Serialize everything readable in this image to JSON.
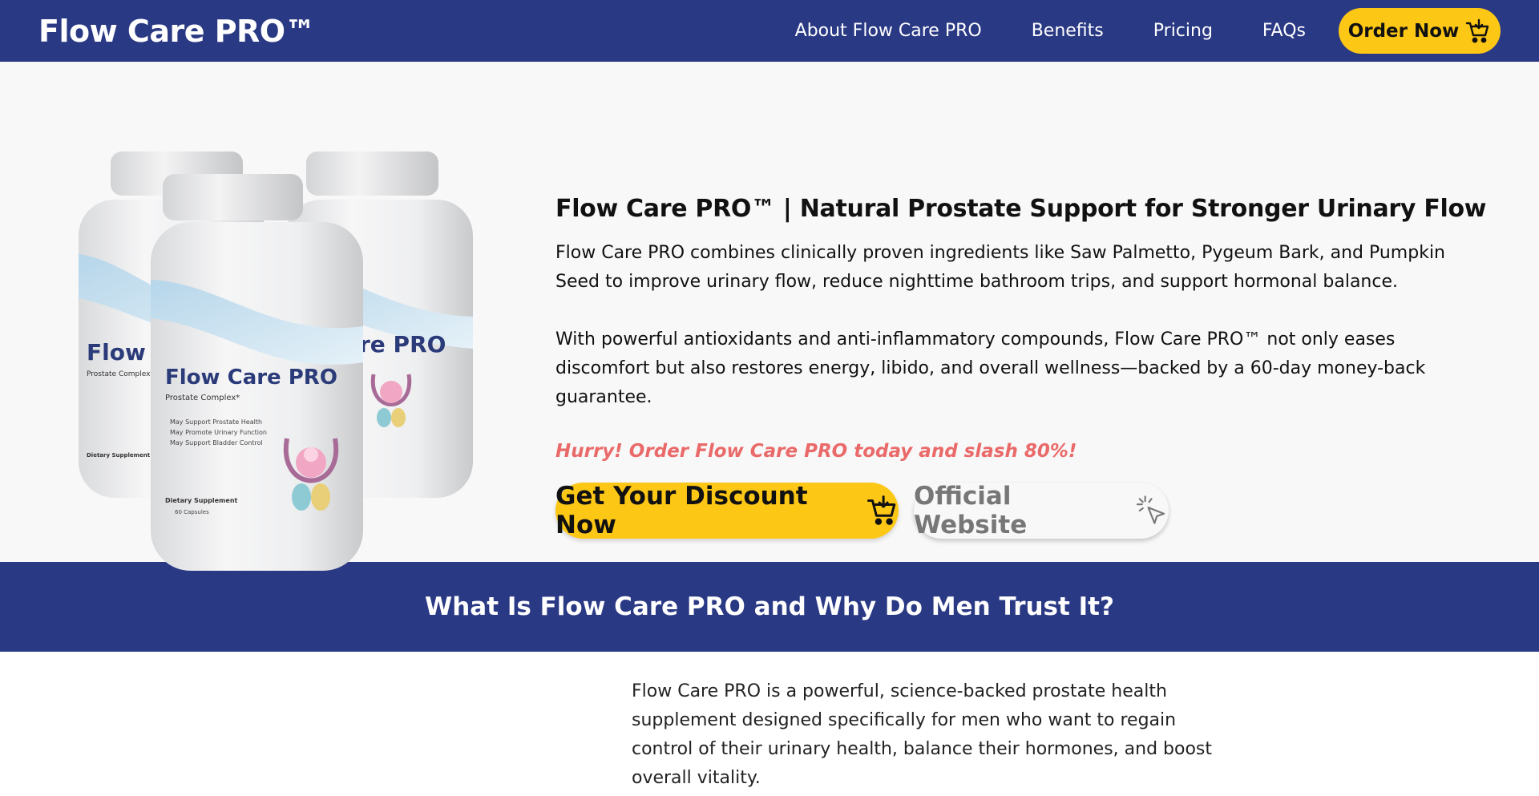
{
  "header": {
    "brand": "Flow Care PRO™",
    "nav": [
      "About Flow Care PRO",
      "Benefits",
      "Pricing",
      "FAQs"
    ],
    "order_label": "Order Now",
    "order_icon": "cart-icon"
  },
  "hero": {
    "product_image": {
      "bottle_brand": "Flow Care PRO",
      "bottle_subtitle": "Prostate Complex*",
      "bottle_bullets": [
        "May Support Prostate Health",
        "May Promote Urinary Function",
        "May Support Bladder Control"
      ],
      "bottle_footer": "Dietary Supplement",
      "bottle_count": "60 Capsules"
    },
    "title": "Flow Care PRO™ | Natural Prostate Support for Stronger Urinary Flow",
    "p1": "Flow Care PRO combines clinically proven ingredients like Saw Palmetto, Pygeum Bark, and Pumpkin Seed to improve urinary flow, reduce nighttime bathroom trips, and support hormonal balance.",
    "p2": "With powerful antioxidants and anti-inflammatory compounds, Flow Care PRO™ not only eases discomfort but also restores energy, libido, and overall wellness—backed by a 60-day money-back guarantee.",
    "hurry": "Hurry! Order Flow Care PRO today and slash 80%!",
    "cta_primary": "Get Your Discount Now",
    "cta_secondary": "Official Website",
    "cta_primary_icon": "cart-icon",
    "cta_secondary_icon": "pointer-click-icon"
  },
  "band": {
    "title": "What Is Flow Care PRO and Why Do Men Trust It?"
  },
  "intro": {
    "text": "Flow Care PRO is a powerful, science-backed prostate health supplement designed specifically for men who want to regain control of their urinary health, balance their hormones, and boost overall vitality."
  },
  "colors": {
    "navy": "#2a3984",
    "yellow": "#fdc716",
    "hurry_red": "#ea6a6a",
    "hero_bg": "#f8f8f8"
  }
}
